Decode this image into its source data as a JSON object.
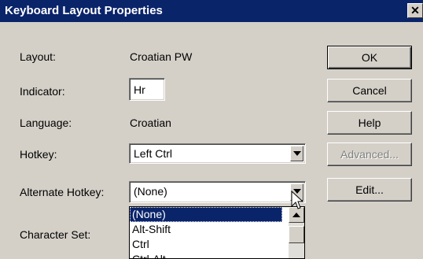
{
  "window": {
    "title": "Keyboard Layout Properties",
    "close_glyph": "✕"
  },
  "fields": {
    "layout_label": "Layout:",
    "layout_value": "Croatian PW",
    "indicator_label": "Indicator:",
    "indicator_value": "Hr",
    "language_label": "Language:",
    "language_value": "Croatian",
    "hotkey_label": "Hotkey:",
    "hotkey_value": "Left Ctrl",
    "alt_hotkey_label": "Alternate Hotkey:",
    "alt_hotkey_value": "(None)",
    "charset_label": "Character Set:"
  },
  "buttons": {
    "ok": "OK",
    "cancel": "Cancel",
    "help": "Help",
    "advanced": "Advanced...",
    "edit": "Edit..."
  },
  "dropdown_list": {
    "items": [
      "(None)",
      "Alt-Shift",
      "Ctrl",
      "Ctrl-Alt"
    ],
    "selected_index": 0
  },
  "colors": {
    "title_bar": "#0a246a",
    "face": "#d4d0c8",
    "selection": "#0a246a"
  }
}
